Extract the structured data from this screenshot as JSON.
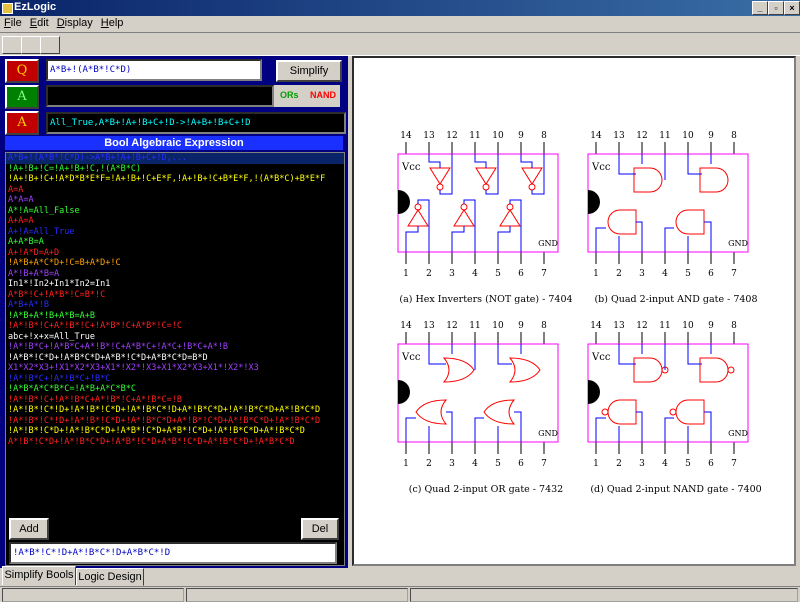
{
  "window": {
    "title": "EzLogic"
  },
  "menu": [
    {
      "key": "F",
      "rest": "ile"
    },
    {
      "key": "E",
      "rest": "dit"
    },
    {
      "key": "D",
      "rest": "isplay"
    },
    {
      "key": "H",
      "rest": "elp"
    }
  ],
  "rows": {
    "q": {
      "button": "Q",
      "expr": "A*B+!(A*B*!C*D)",
      "simplify": "Simplify"
    },
    "a1": {
      "button": "A",
      "ors": "ORs",
      "nand": "NAND"
    },
    "a2": {
      "button": "A",
      "expr": "All_True,A*B+!A+!B+C+!D->!A+B+!B+C+!D"
    }
  },
  "list": {
    "title": "Bool Algebraic Expression",
    "items": [
      {
        "t": "A*B+!(A*B*!C*D)->A*B+!A+!B+C+!D,...",
        "c": "#2b2bff",
        "sel": true
      },
      {
        "t": "!A+!B+!C=!A+!B+!C,!(A*B*C)",
        "c": "#33ff33"
      },
      {
        "t": "!A+!B+!C+!A*D*B*E*F=!A+!B+!C+E*F,!A+!B+!C+B*E*F,!(A*B*C)+B*E*F",
        "c": "#ffff00"
      },
      {
        "t": "A=A",
        "c": "#ff2020"
      },
      {
        "t": "A*A=A",
        "c": "#a040ff"
      },
      {
        "t": "A*!A=All_False",
        "c": "#33ff33"
      },
      {
        "t": "A+A=A",
        "c": "#ff2020"
      },
      {
        "t": "A+!A=All_True",
        "c": "#2b2bff"
      },
      {
        "t": "A+A*B=A",
        "c": "#33ff33"
      },
      {
        "t": "A+!A*D=A+D",
        "c": "#ff2020"
      },
      {
        "t": "!A*B+A*C*D+!C=B+A*D+!C",
        "c": "#ffa000"
      },
      {
        "t": "A*!B+A*B=A",
        "c": "#a040ff"
      },
      {
        "t": "In1*!In2+In1*In2=In1",
        "c": "#ffffff"
      },
      {
        "t": "A*B*!C+!A*B*!C=B*!C",
        "c": "#ff2020"
      },
      {
        "t": "A*B+A*!B",
        "c": "#2b2bff"
      },
      {
        "t": "!A*B+A*!B+A*B=A+B",
        "c": "#33ff33"
      },
      {
        "t": "!A*!B*!C+A*!B*!C+!A*B*!C+A*B*!C=!C",
        "c": "#ff2020"
      },
      {
        "t": "abc+!x+x=All_True",
        "c": "#ffffff"
      },
      {
        "t": "!A*!B*C+!A*B*C+A*!B*!C+A*B*C+!A*C+!B*C+A*!B",
        "c": "#a040ff"
      },
      {
        "t": "!A*B*!C*D+!A*B*C*D+A*B*!C*D+A*B*C*D=B*D",
        "c": "#ffffff"
      },
      {
        "t": "X1*X2*X3+!X1*X2*X3+X1*!X2*!X3+X1*X2*X3+X1*!X2*!X3",
        "c": "#a040ff"
      },
      {
        "t": "!A*!B*C+!A*!B*C+!B*C",
        "c": "#2b2bff"
      },
      {
        "t": "!A*B*A*C*B*C=!A*B+A*C*B*C",
        "c": "#33ff33"
      },
      {
        "t": "!A*!B*!C+!A*!B*C+A*!B*!C+A*!B*C=!B",
        "c": "#ff2020"
      },
      {
        "t": "!A*!B*!C*!D+!A*!B*!C*D+!A*!B*C*!D+A*!B*C*D+!A*!B*C*D+A*!B*C*D",
        "c": "#ffff00"
      },
      {
        "t": "!A*!B*!C*!D+!A*!B*!C*D+!A*!B*C*D+A*!B*!C*D+A*!B*C*D+!A*!B*C*D",
        "c": "#ff2020"
      },
      {
        "t": "!A*!B*!C*D+!A*!B*C*D+!A*B*!C*D+A*B*!C*D+!A*!B*C*D+A*!B*C*D",
        "c": "#ffff00"
      },
      {
        "t": "A*!B*!C*D+!A*!B*C*D+!A*B*!C*D+A*B*!C*D+A*!B*C*D+!A*B*C*D",
        "c": "#ff2020"
      }
    ]
  },
  "bottom": {
    "add": "Add",
    "del": "Del",
    "input": "!A*B*!C*!D+A*!B*C*!D+A*B*C*!D"
  },
  "tabs": [
    {
      "label": "Simplify Bools"
    },
    {
      "label": "Logic Design"
    }
  ],
  "diagram": {
    "chips": [
      {
        "caption": "(a) Hex Inverters (NOT gate) - 7404"
      },
      {
        "caption": "(b) Quad 2-input AND gate - 7408"
      },
      {
        "caption": "(c) Quad 2-input OR gate - 7432"
      },
      {
        "caption": "(d) Quad 2-input NAND gate - 7400"
      }
    ],
    "vcc": "Vcc",
    "gnd": "GND",
    "top_pins": [
      "14",
      "13",
      "12",
      "11",
      "10",
      "9",
      "8"
    ],
    "bottom_pins": [
      "1",
      "2",
      "3",
      "4",
      "5",
      "6",
      "7"
    ]
  },
  "colors": {
    "panel": "#000080",
    "chip_border": "#ff00ff",
    "gate": "#ff0000",
    "wire": "#0000ff"
  }
}
